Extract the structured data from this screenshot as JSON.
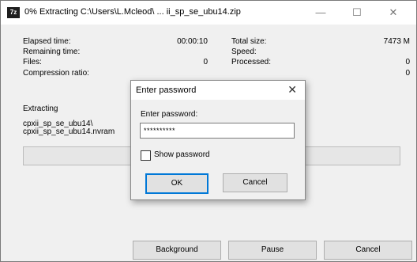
{
  "window": {
    "app_icon": "7z",
    "title": "0% Extracting C:\\Users\\L.Mcleod\\ ... ii_sp_se_ubu14.zip",
    "min_glyph": "—",
    "max_glyph": "☐",
    "close_glyph": "✕"
  },
  "stats": {
    "elapsed_label": "Elapsed time:",
    "elapsed_value": "00:00:10",
    "remaining_label": "Remaining time:",
    "remaining_value": "",
    "files_label": "Files:",
    "files_value": "0",
    "compression_label": "Compression ratio:",
    "compression_value": "",
    "total_label": "Total size:",
    "total_value": "7473 M",
    "speed_label": "Speed:",
    "speed_value": "",
    "processed_label": "Processed:",
    "processed_value": "0",
    "fourth_value": "0"
  },
  "extracting": {
    "label": "Extracting",
    "line1": "cpxii_sp_se_ubu14\\",
    "line2": "cpxii_sp_se_ubu14.nvram"
  },
  "progress": {
    "percent": 0
  },
  "buttons": {
    "background": "Background",
    "pause": "Pause",
    "cancel": "Cancel"
  },
  "dialog": {
    "title": "Enter password",
    "close_glyph": "✕",
    "label": "Enter password:",
    "password_value": "**********",
    "show_password": "Show password",
    "ok": "OK",
    "cancel": "Cancel"
  }
}
